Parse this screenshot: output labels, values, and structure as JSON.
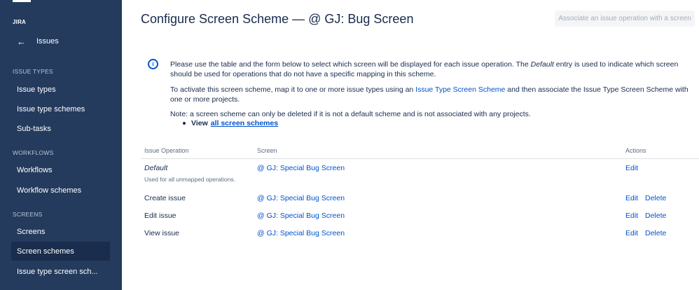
{
  "sidebar": {
    "brand": "JIRA",
    "back_label": "Issues",
    "sections": [
      {
        "title": "ISSUE TYPES",
        "items": [
          "Issue types",
          "Issue type schemes",
          "Sub-tasks"
        ]
      },
      {
        "title": "WORKFLOWS",
        "items": [
          "Workflows",
          "Workflow schemes"
        ]
      },
      {
        "title": "SCREENS",
        "items": [
          "Screens",
          "Screen schemes",
          "Issue type screen sch..."
        ]
      }
    ],
    "active_item": "Screen schemes"
  },
  "header": {
    "title": "Configure Screen Scheme — @ GJ: Bug Screen",
    "action_button": "Associate an issue operation with a screen"
  },
  "info": {
    "p1_a": "Please use the table and the form below to select which screen will be displayed for each issue operation. The ",
    "p1_em": "Default",
    "p1_b": " entry is used to indicate which screen should be used for operations that do not have a specific mapping in this scheme.",
    "p2_a": "To activate this screen scheme, map it to one or more issue types using an ",
    "p2_link": "Issue Type Screen Scheme",
    "p2_b": " and then associate the Issue Type Screen Scheme with one or more projects.",
    "p3": "Note: a screen scheme can only be deleted if it is not a default scheme and is not associated with any projects.",
    "bullet_view": "View",
    "bullet_link": "all screen schemes"
  },
  "table": {
    "headers": {
      "operation": "Issue Operation",
      "screen": "Screen",
      "actions": "Actions"
    },
    "rows": [
      {
        "operation": "Default",
        "note": "Used for all unmapped operations.",
        "screen": "@ GJ: Special Bug Screen",
        "edit": "Edit",
        "delete": ""
      },
      {
        "operation": "Create issue",
        "note": "",
        "screen": "@ GJ: Special Bug Screen",
        "edit": "Edit",
        "delete": "Delete"
      },
      {
        "operation": "Edit issue",
        "note": "",
        "screen": "@ GJ: Special Bug Screen",
        "edit": "Edit",
        "delete": "Delete"
      },
      {
        "operation": "View issue",
        "note": "",
        "screen": "@ GJ: Special Bug Screen",
        "edit": "Edit",
        "delete": "Delete"
      }
    ]
  },
  "colors": {
    "sidebar_bg": "#243b5e",
    "sidebar_active": "#1a2d4d",
    "link": "#0052cc",
    "text": "#172b4d"
  }
}
